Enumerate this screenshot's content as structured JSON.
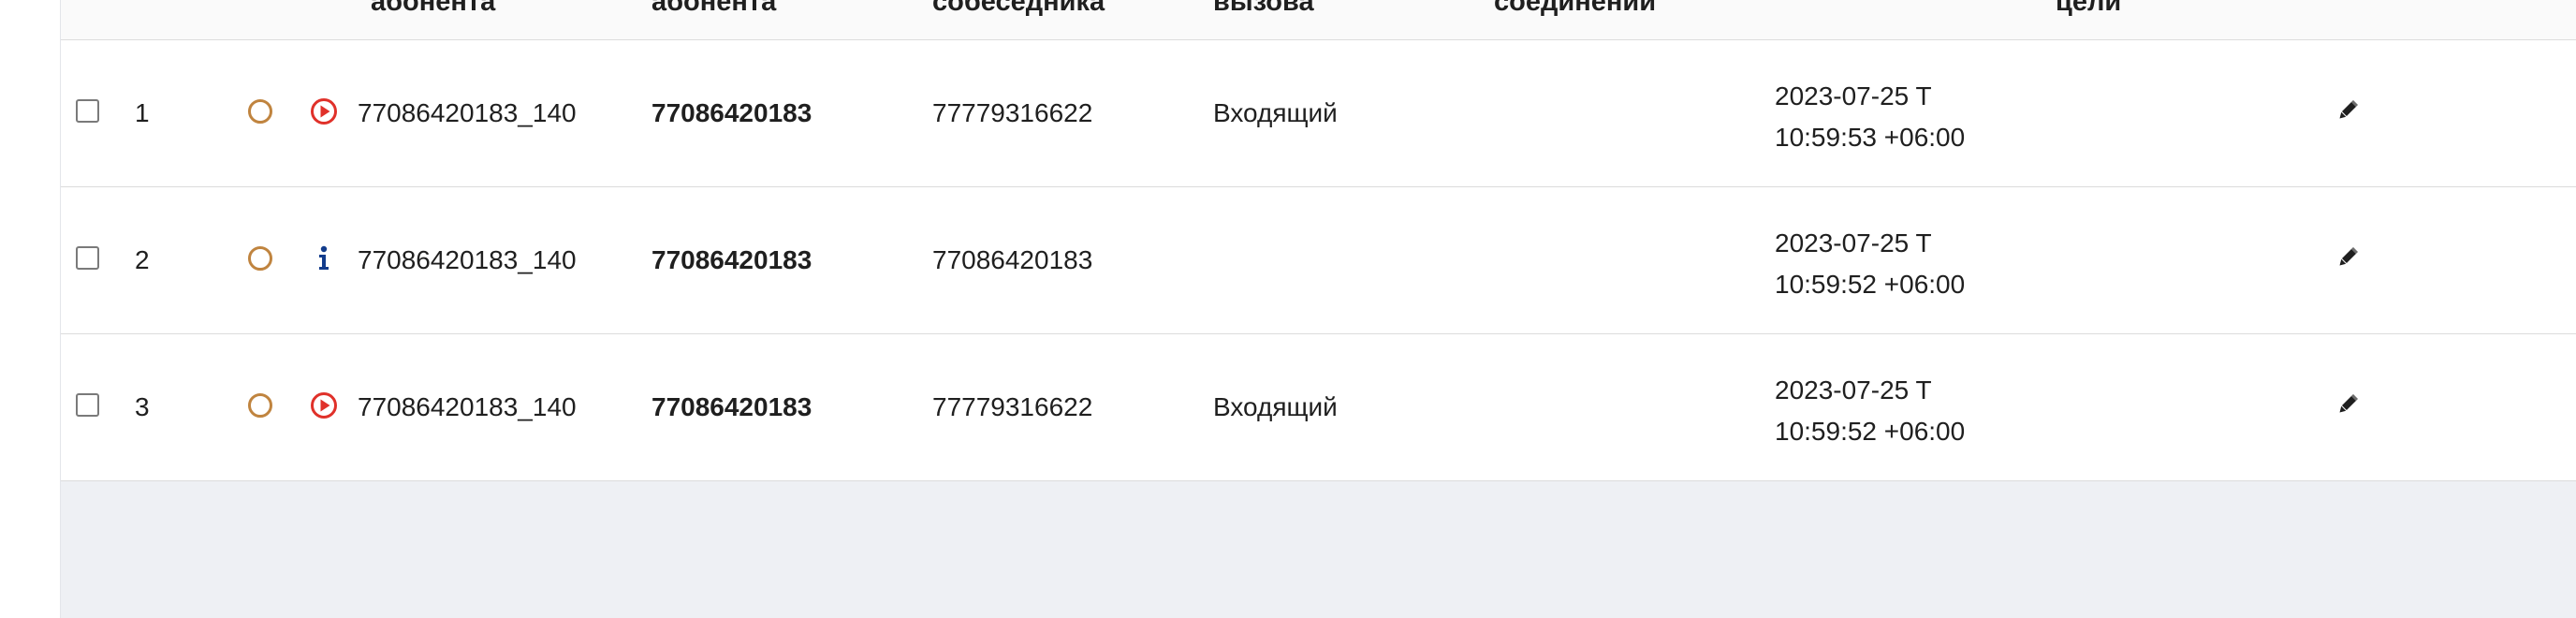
{
  "table": {
    "headers": {
      "subscriber_id": "абонента",
      "subscriber_number": "абонента",
      "peer": "собеседника",
      "call_type": "вызова",
      "connection": "соединений",
      "target": "цели"
    },
    "rows": [
      {
        "num": "1",
        "status_icon": "circle-outline-icon",
        "type_icon": "play-circle-icon",
        "session": "77086420183_140",
        "subscriber": "77086420183",
        "peer": "77779316622",
        "direction": "Входящий",
        "date": "2023-07-25 T",
        "time": "10:59:53 +06:00"
      },
      {
        "num": "2",
        "status_icon": "circle-outline-icon",
        "type_icon": "info-icon",
        "session": "77086420183_140",
        "subscriber": "77086420183",
        "peer": "77086420183",
        "direction": "",
        "date": "2023-07-25 T",
        "time": "10:59:52 +06:00"
      },
      {
        "num": "3",
        "status_icon": "circle-outline-icon",
        "type_icon": "play-circle-icon",
        "session": "77086420183_140",
        "subscriber": "77086420183",
        "peer": "77779316622",
        "direction": "Входящий",
        "date": "2023-07-25 T",
        "time": "10:59:52 +06:00"
      }
    ]
  },
  "colors": {
    "status_ring": "#c0843f",
    "play_icon": "#e0312a",
    "info_icon": "#123c8c",
    "empty_area": "#eef0f4"
  }
}
